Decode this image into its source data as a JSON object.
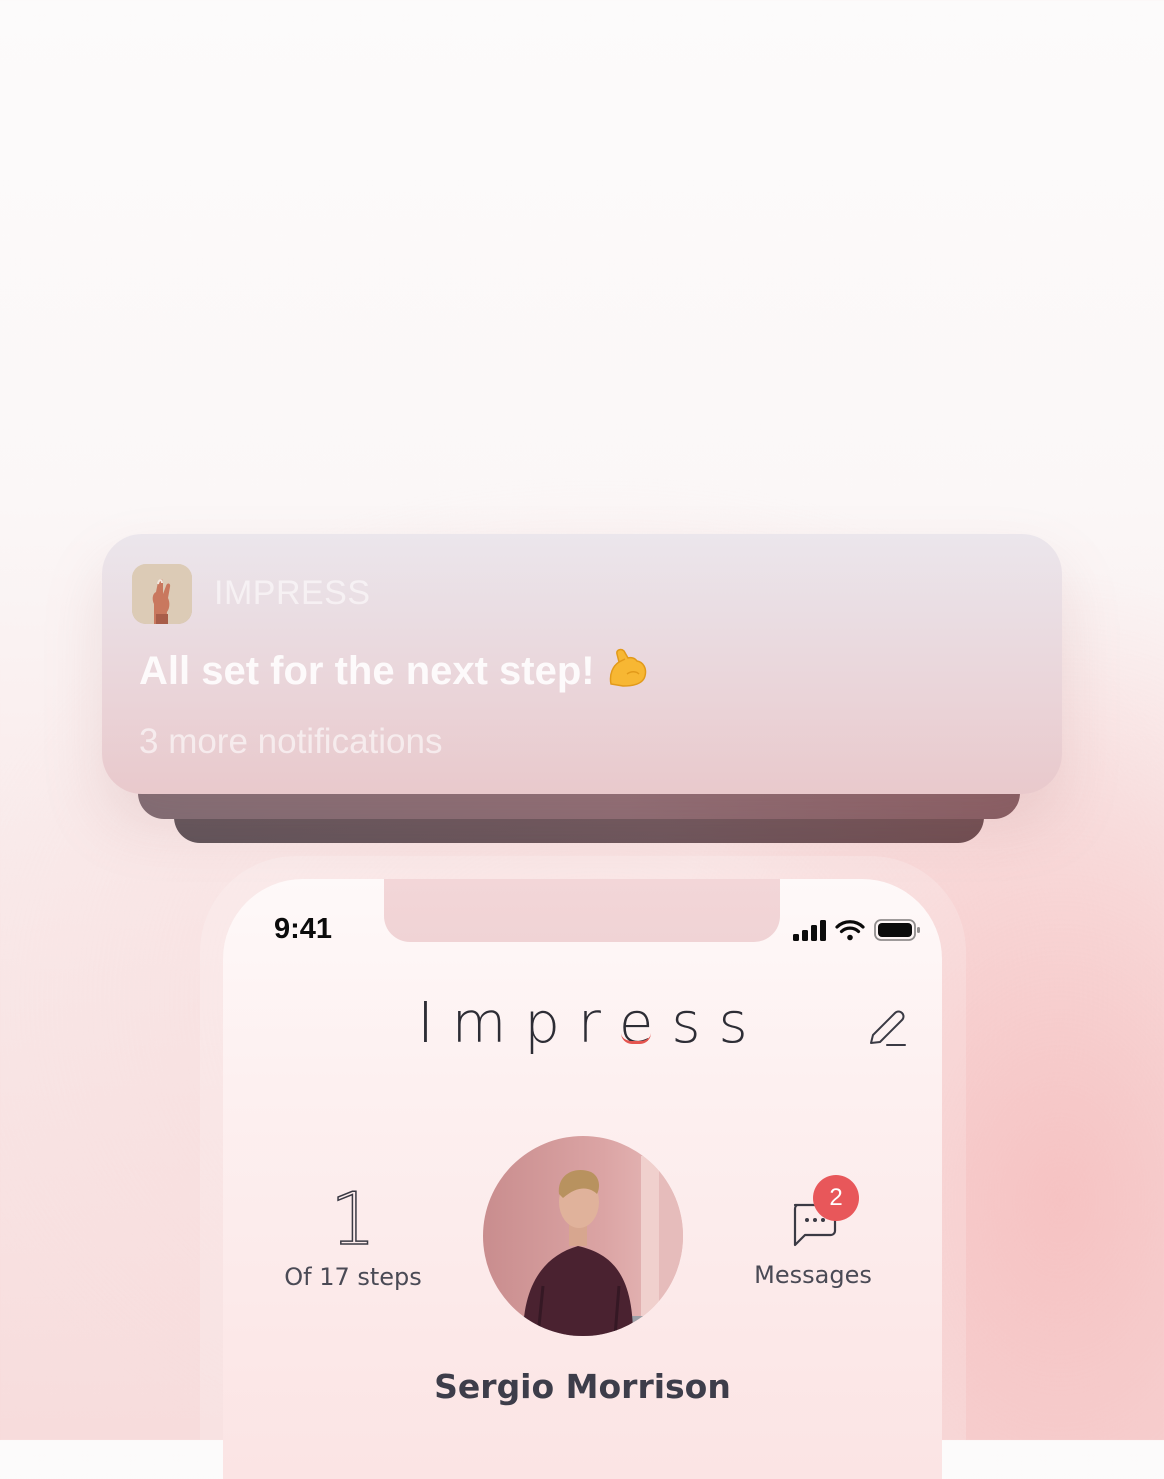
{
  "notification": {
    "app_name": "IMPRESS",
    "title": "All set for the next step!",
    "emoji": "💪",
    "more_text": "3 more notifications"
  },
  "status_bar": {
    "time": "9:41"
  },
  "header": {
    "brand_pre": "Impr",
    "brand_e": "e",
    "brand_post": "ss"
  },
  "profile": {
    "steps_number": "1",
    "steps_label": "Of 17 steps",
    "messages_label": "Messages",
    "messages_badge": "2",
    "name": "Sergio Morrison"
  },
  "colors": {
    "accent_red": "#e8575a",
    "text_dark": "#3d3d4a"
  }
}
